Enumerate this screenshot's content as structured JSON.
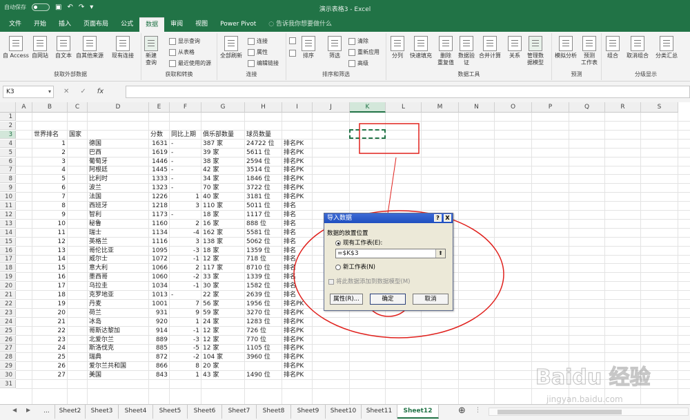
{
  "window": {
    "title": "演示表格3 - Excel",
    "autosave": "自动保存"
  },
  "tabs": [
    "文件",
    "开始",
    "插入",
    "页面布局",
    "公式",
    "数据",
    "审阅",
    "视图",
    "Power Pivot"
  ],
  "active_tab": "数据",
  "tell_me": "告诉我你想要做什么",
  "ribbon": {
    "g1": {
      "label": "获取外部数据",
      "buttons": [
        "自 Access",
        "自网站",
        "自文本",
        "自其他来源",
        "现有连接"
      ]
    },
    "g2": {
      "label": "获取和转换",
      "big": "新建\n查询",
      "small": [
        "显示查询",
        "从表格",
        "最近使用的源"
      ]
    },
    "g3": {
      "label": "连接",
      "big": "全部刷新",
      "small": [
        "连接",
        "属性",
        "编辑链接"
      ]
    },
    "g4": {
      "label": "排序和筛选",
      "buttons": [
        "排序",
        "筛选"
      ],
      "small": [
        "清除",
        "重新应用",
        "高级"
      ]
    },
    "g5": {
      "label": "数据工具",
      "buttons": [
        "分列",
        "快速填充",
        "删除\n重复值",
        "数据验\n证",
        "合并计算",
        "关系",
        "管理数\n据模型"
      ]
    },
    "g6": {
      "label": "预测",
      "buttons": [
        "模拟分析",
        "预测\n工作表"
      ]
    },
    "g7": {
      "label": "分级显示",
      "buttons": [
        "组合",
        "取消组合",
        "分类汇总"
      ]
    }
  },
  "formula_bar": {
    "name_box": "K3",
    "fx": "fx",
    "value": ""
  },
  "columns": [
    "A",
    "B",
    "C",
    "D",
    "E",
    "F",
    "G",
    "H",
    "I",
    "J",
    "K",
    "L",
    "M",
    "N",
    "O",
    "P",
    "Q",
    "R",
    "S"
  ],
  "selected_col": "K",
  "selected_row": "3",
  "rows": [
    "1",
    "2",
    "3",
    "4",
    "5",
    "6",
    "7",
    "8",
    "9",
    "10",
    "11",
    "12",
    "13",
    "14",
    "15",
    "16",
    "17",
    "18",
    "19",
    "20",
    "21",
    "22",
    "23",
    "24",
    "25",
    "26",
    "27",
    "28",
    "29",
    "30",
    "31"
  ],
  "header": {
    "rank": "世界排名",
    "country": "国家",
    "score": "分数",
    "change": "同比上期",
    "clubs": "俱乐部数量",
    "players": "球员数量"
  },
  "data": [
    {
      "rank": "1",
      "country": "德国",
      "score": "1631",
      "change": "-",
      "clubs": "387 家",
      "players": "24722 位",
      "pk": "排名PK"
    },
    {
      "rank": "2",
      "country": "巴西",
      "score": "1619",
      "change": "-",
      "clubs": "39 家",
      "players": "5611 位",
      "pk": "排名PK"
    },
    {
      "rank": "3",
      "country": "葡萄牙",
      "score": "1446",
      "change": "-",
      "clubs": "38 家",
      "players": "2594 位",
      "pk": "排名PK"
    },
    {
      "rank": "4",
      "country": "阿根廷",
      "score": "1445",
      "change": "-",
      "clubs": "42 家",
      "players": "3514 位",
      "pk": "排名PK"
    },
    {
      "rank": "5",
      "country": "比利时",
      "score": "1333",
      "change": "-",
      "clubs": "34 家",
      "players": "1846 位",
      "pk": "排名PK"
    },
    {
      "rank": "6",
      "country": "波兰",
      "score": "1323",
      "change": "-",
      "clubs": "70 家",
      "players": "3722 位",
      "pk": "排名PK"
    },
    {
      "rank": "7",
      "country": "法国",
      "score": "1226",
      "change": "1",
      "clubs": "40 家",
      "players": "3181 位",
      "pk": "排名PK"
    },
    {
      "rank": "8",
      "country": "西班牙",
      "score": "1218",
      "change": "3",
      "clubs": "110 家",
      "players": "5011 位",
      "pk": "排名"
    },
    {
      "rank": "9",
      "country": "智利",
      "score": "1173",
      "change": "-",
      "clubs": "18 家",
      "players": "1117 位",
      "pk": "排名"
    },
    {
      "rank": "10",
      "country": "秘鲁",
      "score": "1160",
      "change": "2",
      "clubs": "16 家",
      "players": "888 位",
      "pk": "排名"
    },
    {
      "rank": "11",
      "country": "瑞士",
      "score": "1134",
      "change": "-4",
      "clubs": "162 家",
      "players": "5581 位",
      "pk": "排名"
    },
    {
      "rank": "12",
      "country": "英格兰",
      "score": "1116",
      "change": "3",
      "clubs": "138 家",
      "players": "5062 位",
      "pk": "排名"
    },
    {
      "rank": "13",
      "country": "哥伦比亚",
      "score": "1095",
      "change": "-3",
      "clubs": "18 家",
      "players": "1359 位",
      "pk": "排名"
    },
    {
      "rank": "14",
      "country": "威尔士",
      "score": "1072",
      "change": "-1",
      "clubs": "12 家",
      "players": "718 位",
      "pk": "排名"
    },
    {
      "rank": "15",
      "country": "意大利",
      "score": "1066",
      "change": "2",
      "clubs": "117 家",
      "players": "8710 位",
      "pk": "排名"
    },
    {
      "rank": "16",
      "country": "墨西哥",
      "score": "1060",
      "change": "-2",
      "clubs": "33 家",
      "players": "1339 位",
      "pk": "排名"
    },
    {
      "rank": "17",
      "country": "乌拉圭",
      "score": "1034",
      "change": "-1",
      "clubs": "30 家",
      "players": "1582 位",
      "pk": "排名"
    },
    {
      "rank": "18",
      "country": "克罗地亚",
      "score": "1013",
      "change": "-",
      "clubs": "22 家",
      "players": "2639 位",
      "pk": "排名"
    },
    {
      "rank": "19",
      "country": "丹麦",
      "score": "1001",
      "change": "7",
      "clubs": "56 家",
      "players": "1956 位",
      "pk": "排名PK"
    },
    {
      "rank": "20",
      "country": "荷兰",
      "score": "931",
      "change": "9",
      "clubs": "59 家",
      "players": "3270 位",
      "pk": "排名PK"
    },
    {
      "rank": "21",
      "country": "冰岛",
      "score": "920",
      "change": "1",
      "clubs": "24 家",
      "players": "1283 位",
      "pk": "排名PK"
    },
    {
      "rank": "22",
      "country": "哥斯达黎加",
      "score": "914",
      "change": "-1",
      "clubs": "12 家",
      "players": "726 位",
      "pk": "排名PK"
    },
    {
      "rank": "23",
      "country": "北爱尔兰",
      "score": "889",
      "change": "-3",
      "clubs": "12 家",
      "players": "770 位",
      "pk": "排名PK"
    },
    {
      "rank": "24",
      "country": "斯洛伐克",
      "score": "885",
      "change": "-5",
      "clubs": "12 家",
      "players": "1105 位",
      "pk": "排名PK"
    },
    {
      "rank": "25",
      "country": "瑞典",
      "score": "872",
      "change": "-2",
      "clubs": "104 家",
      "players": "3960 位",
      "pk": "排名PK"
    },
    {
      "rank": "26",
      "country": "爱尔兰共和国",
      "score": "866",
      "change": "8",
      "clubs": "20 家",
      "players": "",
      "pk": "排名PK"
    },
    {
      "rank": "27",
      "country": "美国",
      "score": "843",
      "change": "1",
      "clubs": "43 家",
      "players": "1490 位",
      "pk": "排名PK"
    }
  ],
  "dialog": {
    "title": "导入数据",
    "help": "?",
    "close": "X",
    "section": "数据的放置位置",
    "opt_existing": "现有工作表(E):",
    "input_value": "=$K$3",
    "opt_new": "新工作表(N)",
    "checkbox": "将此数据添加到数据模型(M)",
    "btn_props": "属性(R)...",
    "btn_ok": "确定",
    "btn_cancel": "取消"
  },
  "sheets": [
    "...",
    "Sheet2",
    "Sheet3",
    "Sheet4",
    "Sheet5",
    "Sheet6",
    "Sheet7",
    "Sheet8",
    "Sheet9",
    "Sheet10",
    "Sheet11",
    "Sheet12"
  ],
  "active_sheet": "Sheet12",
  "watermark": {
    "brand": "Baidu 经验",
    "url": "jingyan.baidu.com"
  },
  "colors": {
    "excel_green": "#217346",
    "annotation_red": "#e0201c"
  }
}
